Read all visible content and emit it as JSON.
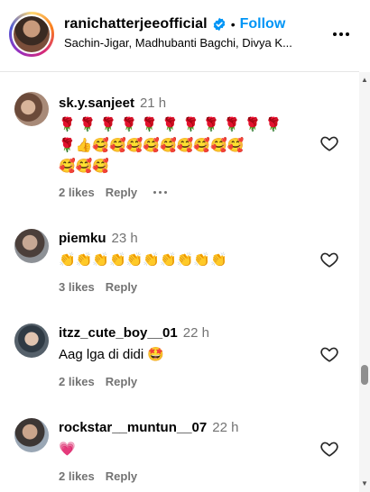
{
  "post": {
    "owner": "ranichatterjeeofficial",
    "separator": "•",
    "follow_label": "Follow",
    "audio": "Sachin-Jigar, Madhubanti Bagchi, Divya K..."
  },
  "comments": [
    {
      "username": "sk.y.sanjeet",
      "time": "21 h",
      "text_lines": [
        "🌹 🌹 🌹 🌹 🌹 🌹 🌹 🌹 🌹 🌹 🌹",
        "🌹👍🥰🥰🥰🥰🥰🥰🥰🥰🥰",
        "🥰🥰🥰"
      ],
      "likes": "2 likes",
      "reply": "Reply"
    },
    {
      "username": "piemku",
      "time": "23 h",
      "text_lines": [
        "👏👏👏👏👏👏👏👏👏👏"
      ],
      "likes": "3 likes",
      "reply": "Reply"
    },
    {
      "username": "itzz_cute_boy__01",
      "time": "22 h",
      "text_lines": [
        "Aag lga di didi 🤩"
      ],
      "likes": "2 likes",
      "reply": "Reply"
    },
    {
      "username": "rockstar__muntun__07",
      "time": "22 h",
      "text_lines": [
        "💗"
      ],
      "likes": "2 likes",
      "reply": "Reply"
    }
  ],
  "icons": {
    "more": "more-options-icon",
    "verified": "verified-badge-icon",
    "heart": "heart-outline-icon"
  },
  "colors": {
    "follow": "#0095f6",
    "verified": "#0095f6",
    "muted": "#737373"
  }
}
